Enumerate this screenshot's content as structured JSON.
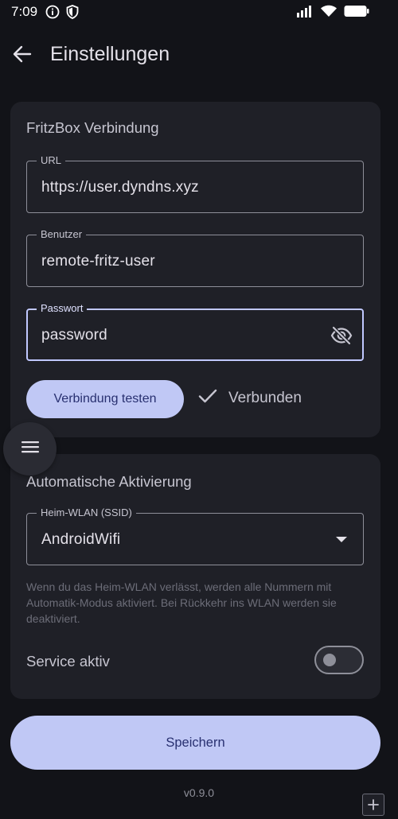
{
  "status_bar": {
    "time": "7:09",
    "icons": [
      "info-icon",
      "shield-icon",
      "signal-icon",
      "wifi-icon",
      "battery-icon"
    ]
  },
  "app_bar": {
    "title": "Einstellungen",
    "back_icon": "arrow-back-icon"
  },
  "connection_card": {
    "title": "FritzBox Verbindung",
    "url_field": {
      "label": "URL",
      "value": "https://user.dyndns.xyz"
    },
    "user_field": {
      "label": "Benutzer",
      "value": "remote-fritz-user"
    },
    "password_field": {
      "label": "Passwort",
      "value": "password",
      "icon": "visibility-off-icon"
    },
    "test_button_label": "Verbindung testen",
    "status_label": "Verbunden",
    "status_icon": "check-icon"
  },
  "auto_card": {
    "title": "Automatische Aktivierung",
    "ssid_field": {
      "label": "Heim-WLAN (SSID)",
      "value": "AndroidWifi",
      "icon": "dropdown-arrow-icon"
    },
    "help_text": "Wenn du das Heim-WLAN verlässt, werden alle Nummern mit Automatik-Modus aktiviert. Bei Rückkehr ins WLAN werden sie deaktiviert.",
    "service_label": "Service aktiv",
    "service_enabled": false
  },
  "save_button_label": "Speichern",
  "version": "v0.9.0",
  "colors": {
    "background": "#121318",
    "card": "#1f2027",
    "accent": "#c0c8f5",
    "focus": "#c0c8ff"
  }
}
